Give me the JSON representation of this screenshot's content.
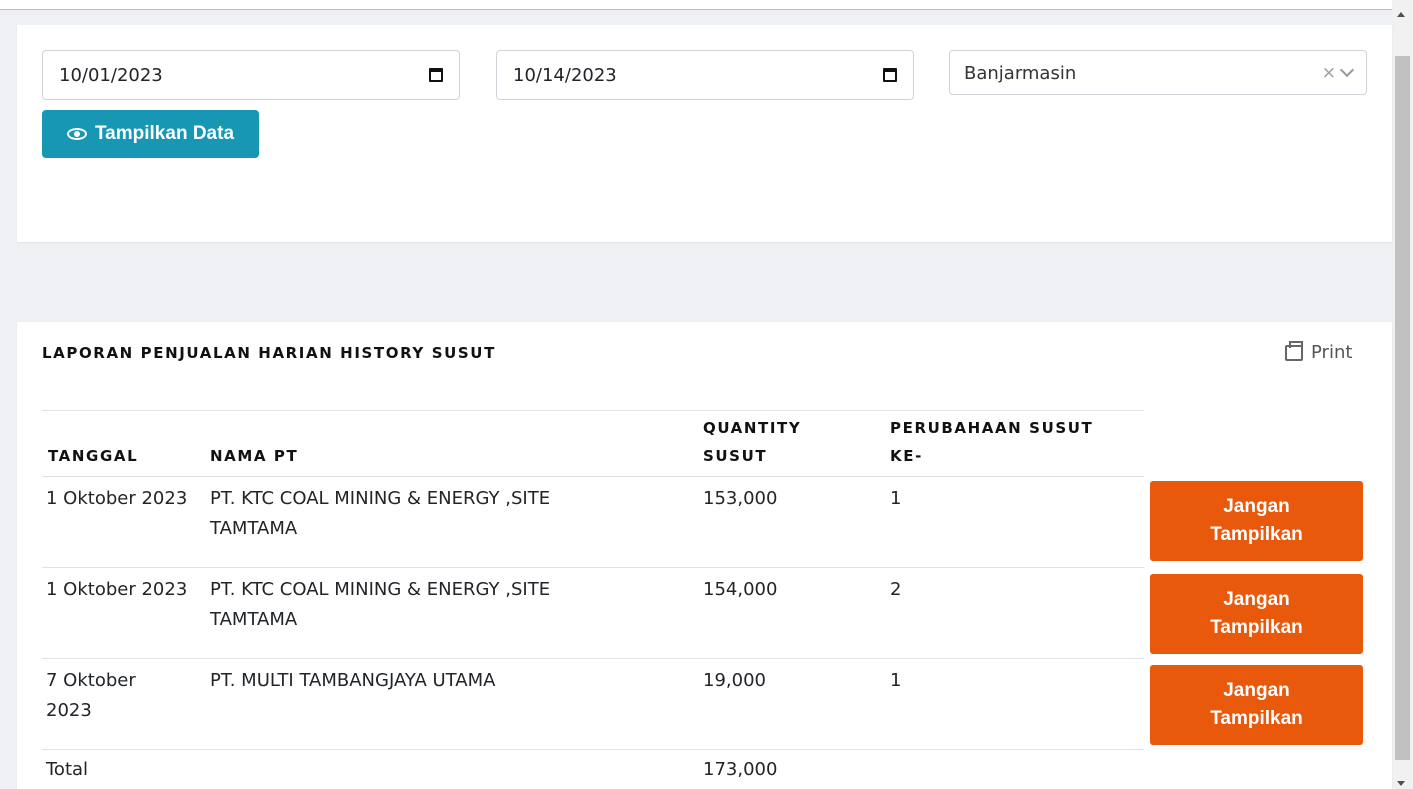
{
  "filter": {
    "date_from": "10/01/2023",
    "date_to": "10/14/2023",
    "location": "Banjarmasin",
    "clear_symbol": "×",
    "show_button_label": "Tampilkan Data",
    "icons": {
      "show_button": "eye-icon",
      "date": "calendar-icon"
    }
  },
  "report": {
    "title": "LAPORAN PENJUALAN HARIAN HISTORY SUSUT",
    "print_label": "Print",
    "columns": {
      "tanggal": "TANGGAL",
      "nama_pt": "NAMA PT",
      "quantity_line1": "QUANTITY",
      "quantity_line2": "SUSUT",
      "perubahaan_line1": "PERUBAHAAN SUSUT",
      "perubahaan_line2": "KE-"
    },
    "rows": [
      {
        "tanggal_line1": "1 Oktober 2023",
        "tanggal_line2": "",
        "nama_line1": "PT. KTC COAL MINING & ENERGY ,SITE",
        "nama_line2": "TAMTAMA",
        "quantity": "153,000",
        "perubahaan": "1",
        "action_line1": "Jangan",
        "action_line2": "Tampilkan"
      },
      {
        "tanggal_line1": "1 Oktober 2023",
        "tanggal_line2": "",
        "nama_line1": "PT. KTC COAL MINING & ENERGY ,SITE",
        "nama_line2": "TAMTAMA",
        "quantity": "154,000",
        "perubahaan": "2",
        "action_line1": "Jangan",
        "action_line2": "Tampilkan"
      },
      {
        "tanggal_line1": "7 Oktober",
        "tanggal_line2": "2023",
        "nama_line1": "PT. MULTI TAMBANGJAYA UTAMA",
        "nama_line2": "",
        "quantity": "19,000",
        "perubahaan": "1",
        "action_line1": "Jangan",
        "action_line2": "Tampilkan"
      }
    ],
    "total_label": "Total",
    "total_quantity": "173,000"
  },
  "colors": {
    "primary_button": "#1797b4",
    "danger_button": "#e8590c",
    "page_background": "#eef0f4"
  }
}
